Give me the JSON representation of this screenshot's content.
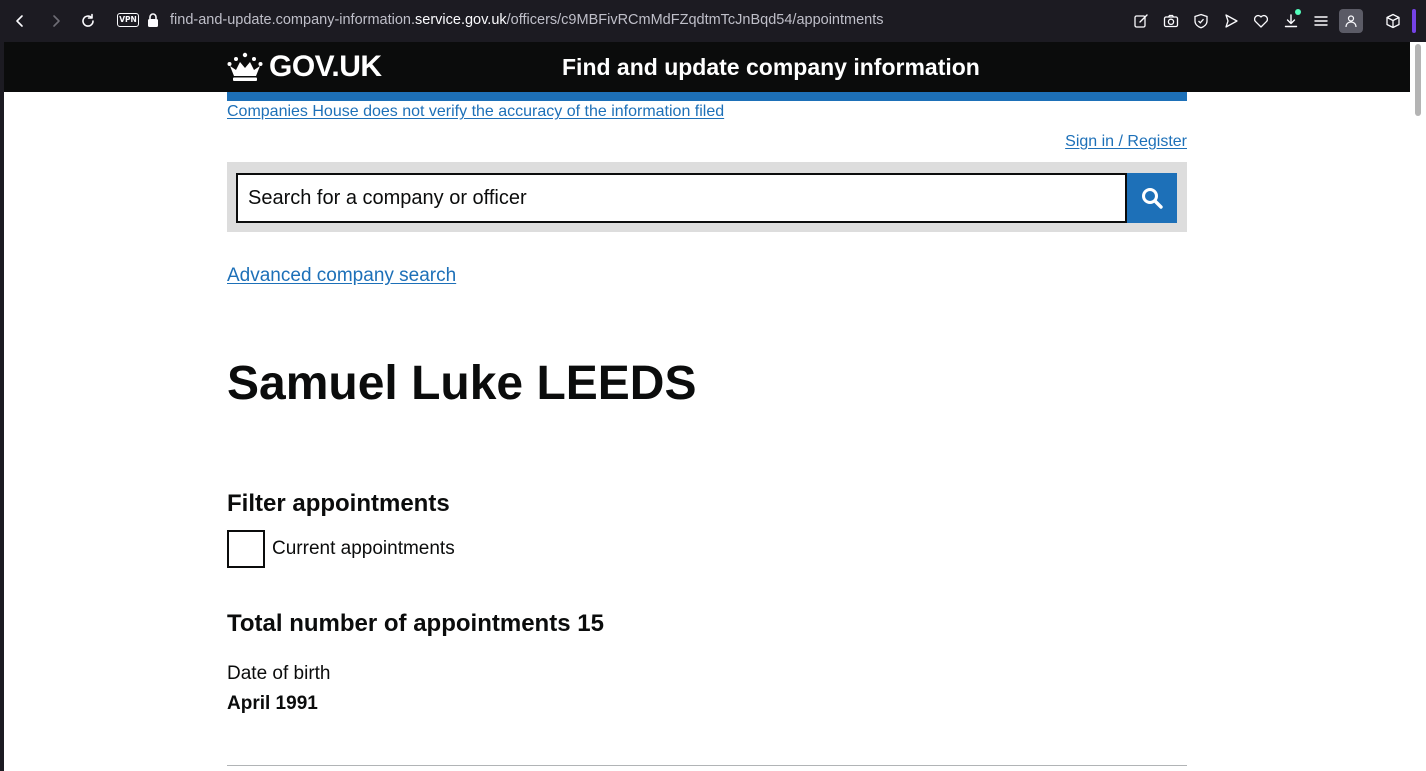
{
  "browser": {
    "url_prefix": "find-and-update.company-information.",
    "url_host": "service.gov.uk",
    "url_path": "/officers/c9MBFivRCmMdFZqdtmTcJnBqd54/appointments",
    "vpn_label": "VPN",
    "icons": [
      "back-icon",
      "forward-icon",
      "reload-icon",
      "lock-icon",
      "edit-icon",
      "camera-icon",
      "shield-icon",
      "send-icon",
      "heart-icon",
      "download-icon",
      "menu-icon",
      "profile-icon",
      "box-icon"
    ],
    "accent_color": "#7542e5"
  },
  "header": {
    "logo_text": "GOV.UK",
    "service_name": "Find and update company information"
  },
  "banner": {
    "disclaimer": "Companies House does not verify the accuracy of the information filed",
    "sign_in": "Sign in / Register"
  },
  "search": {
    "placeholder": "Search for a company or officer",
    "value": "",
    "button_icon": "search-icon"
  },
  "advanced_search": "Advanced company search",
  "officer": {
    "name": "Samuel Luke LEEDS"
  },
  "filter": {
    "heading": "Filter appointments",
    "checkbox_label": "Current appointments",
    "checked": false
  },
  "appointments": {
    "total_heading": "Total number of appointments 15",
    "dob_label": "Date of birth",
    "dob_value": "April 1991"
  },
  "colors": {
    "gov_black": "#0b0c0c",
    "gov_blue": "#1d70b8",
    "search_panel": "#dddddd"
  }
}
